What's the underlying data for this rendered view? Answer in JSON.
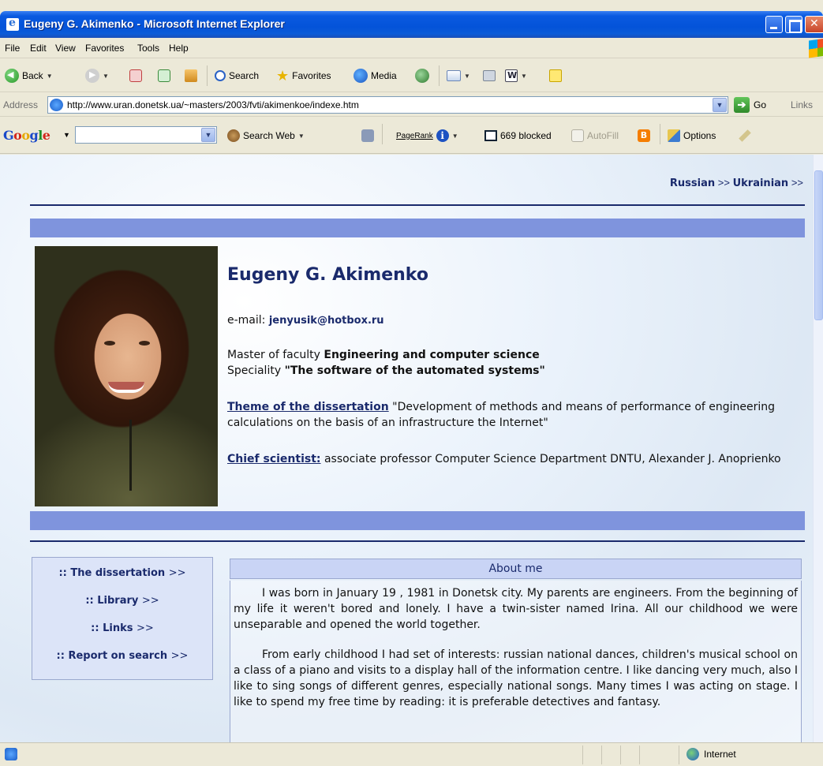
{
  "window": {
    "title": "Eugeny G. Akimenko - Microsoft Internet Explorer"
  },
  "menu": [
    "File",
    "Edit",
    "View",
    "Favorites",
    "Tools",
    "Help"
  ],
  "toolbar": {
    "back": "Back",
    "search": "Search",
    "favorites": "Favorites",
    "media": "Media"
  },
  "address": {
    "label": "Address",
    "url": "http://www.uran.donetsk.ua/~masters/2003/fvti/akimenkoe/indexe.htm",
    "go": "Go",
    "links": "Links"
  },
  "google": {
    "search_web": "Search Web",
    "pagerank": "PageRank",
    "blocked": "669 blocked",
    "autofill": "AutoFill",
    "options": "Options"
  },
  "page": {
    "lang_russian": "Russian",
    "lang_ukrainian": "Ukrainian",
    "lang_sep": ">>",
    "name": "Eugeny G. Akimenko",
    "email_label": "e-mail:",
    "email": "jenyusik@hotbox.ru",
    "master_prefix": "Master of faculty",
    "faculty": "Engineering and computer science",
    "speciality_prefix": "Speciality",
    "speciality": "\"The software of the automated systems\"",
    "theme_label": "Theme of the dissertation",
    "theme_text": "\"Development of methods and means of performance of engineering calculations on the basis of an infrastructure the Internet\"",
    "chief_label": "Chief scientist:",
    "chief_text": "associate professor Computer Science Department DNTU, Alexander J. Anoprienko",
    "nav": [
      {
        "label": ":: The dissertation",
        "arrow": ">>"
      },
      {
        "label": ":: Library",
        "arrow": ">>"
      },
      {
        "label": ":: Links",
        "arrow": ">>"
      },
      {
        "label": ":: Report on search",
        "arrow": ">>"
      }
    ],
    "about_title": "About me",
    "about_p1": "I was born in January 19 , 1981 in Donetsk city. My parents are engineers. From the beginning of my life it weren't bored and lonely. I have a twin-sister named Irina. All our childhood we were unseparable and opened the world together.",
    "about_p2": "From early childhood I had set of interests: russian national dances, children's musical school on a class of a piano and visits to a display hall of the information centre. I like dancing very much, also I like to sing songs of different genres, especially national songs. Many times I was acting on stage. I like to spend my free time by reading: it is preferable detectives and fantasy."
  },
  "status": {
    "zone": "Internet"
  }
}
